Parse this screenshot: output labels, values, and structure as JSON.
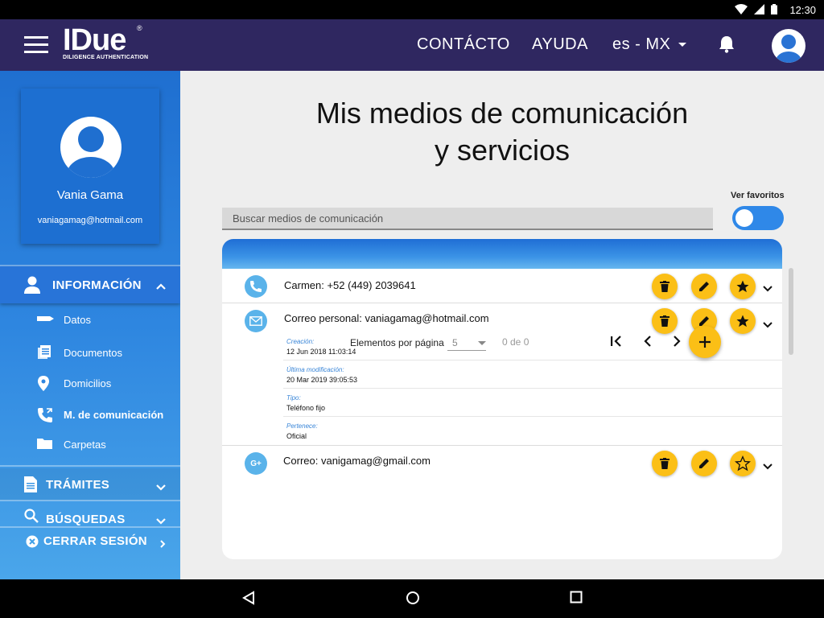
{
  "status_bar": {
    "time": "12:30"
  },
  "header": {
    "logo_text": "IDue",
    "logo_subtitle": "DILIGENCE AUTHENTICATION",
    "logo_mark": "®",
    "nav": {
      "contacto": "CONTÁCTO",
      "ayuda": "AYUDA",
      "language": "es - MX"
    }
  },
  "sidebar": {
    "profile": {
      "name": "Vania Gama",
      "email": "vaniagamag@hotmail.com"
    },
    "sections": {
      "informacion": "INFORMACIÓN",
      "tramites": "TRÁMITES",
      "busquedas": "BÚSQUEDAS",
      "cerrar": "CERRAR SESIÓN"
    },
    "items": {
      "datos": "Datos",
      "documentos": "Documentos",
      "domicilios": "Domicilios",
      "comunicacion": "M. de comunicación",
      "carpetas": "Carpetas"
    }
  },
  "main": {
    "title_line1": "Mis medios de comunicación",
    "title_line2": "y servicios",
    "ver_favoritos": "Ver favoritos",
    "favorites_toggle_on": false,
    "search_placeholder": "Buscar medios de comunicación",
    "rows": [
      {
        "icon": "phone-icon",
        "text": "Carmen: +52 (449) 2039641",
        "favorite": true
      },
      {
        "icon": "mail-icon",
        "text": "Correo personal:  vaniagamag@hotmail.com",
        "favorite": true,
        "details": [
          {
            "label": "Creación:",
            "value": "12 Jun 2018 11:03:14"
          },
          {
            "label": "Última modificación:",
            "value": "20 Mar 2019 39:05:53"
          },
          {
            "label": "Tipo:",
            "value": "Teléfono fijo"
          },
          {
            "label": "Pertenece:",
            "value": "Oficial"
          }
        ]
      },
      {
        "icon": "google-plus-icon",
        "text": "Correo: vanigamag@gmail.com",
        "favorite": false
      }
    ],
    "google_plus_glyph": "G+",
    "pager": {
      "label": "Elementos por página",
      "page_size": "5",
      "count": "0 de 0",
      "fab_glyph": "+"
    }
  },
  "colors": {
    "header_bg": "#2f2760",
    "sidebar_blue": "#1f6fd0",
    "accent_yellow": "#fbbf16",
    "icon_blue": "#5ab3ea"
  }
}
